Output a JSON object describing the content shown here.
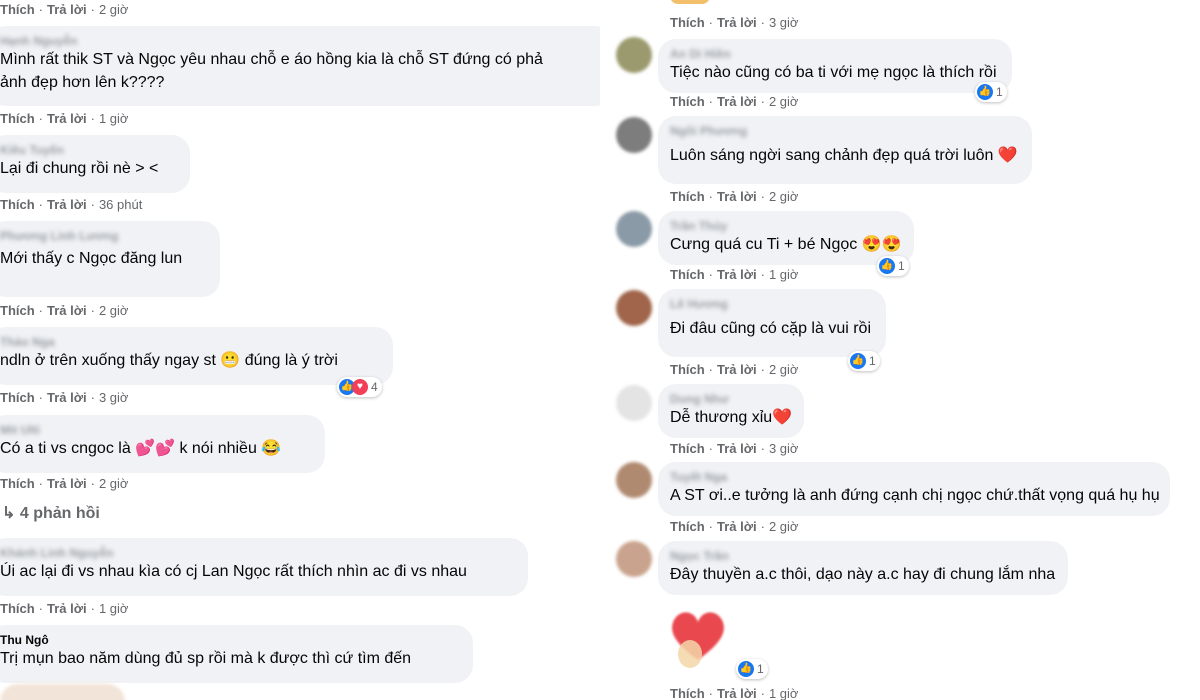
{
  "labels": {
    "like": "Thích",
    "reply": "Trả lời"
  },
  "left": {
    "top_time": "2 giờ",
    "comments": [
      {
        "author": "Hạnh Nguyễn",
        "lines": [
          "Mình rất thik ST và Ngọc yêu nhau chỗ e áo hồng kia là chỗ ST đứng có phả",
          "ảnh đẹp hơn lên k????"
        ],
        "time": "1 giờ"
      },
      {
        "author": "Kiều Tuyến",
        "lines": [
          "Lại đi chung rồi nè > <"
        ],
        "time": "36 phút"
      },
      {
        "author": "Phương Linh Lương",
        "lines": [
          "Mới thấy c Ngọc đăng lun"
        ],
        "time": "2 giờ"
      },
      {
        "author": "Thảo Nga",
        "lines": [
          "ndln ở trên xuống thấy ngay st 😬 đúng là ý trời"
        ],
        "time": "3 giờ",
        "reactions": "4"
      },
      {
        "author": "Mit Ulti",
        "lines": [
          "Có a ti vs cngoc là 💕💕 k nói nhiều 😂"
        ],
        "time": "2 giờ"
      },
      {
        "author": "Khánh Linh Nguyễn",
        "lines": [
          "Úi ac lại đi vs nhau kìa có cj Lan Ngọc rất thích nhìn ac đi vs nhau"
        ],
        "time": "1 giờ"
      },
      {
        "author": "Thu Ngô",
        "lines": [
          "Trị mụn bao năm dùng đủ sp rồi mà k được thì cứ tìm đến"
        ]
      }
    ],
    "replies_label": "4 phản hồi"
  },
  "right": {
    "top_time": "3 giờ",
    "comments": [
      {
        "author": "An Di Hiền",
        "text": "Tiệc nào cũng có ba ti với mẹ ngọc là thích rồi",
        "time": "2 giờ",
        "reactions": "1"
      },
      {
        "author": "Ngôi Phương",
        "text": "Luôn sáng ngời sang chảnh đẹp quá trời luôn ❤️",
        "time": "2 giờ"
      },
      {
        "author": "Trần Thủy",
        "text": "Cưng quá cu Ti + bé Ngọc 😍😍",
        "time": "1 giờ",
        "reactions": "1"
      },
      {
        "author": "Lê Hương",
        "text": "Đi đâu cũng có cặp là vui rồi",
        "time": "2 giờ",
        "reactions": "1"
      },
      {
        "author": "Dung Như",
        "text": "Dễ thương xỉu❤️",
        "time": "3 giờ"
      },
      {
        "author": "Tuyết Nga",
        "text": "A ST ơi..e tưởng là anh đứng cạnh chị ngọc chứ.thất vọng quá hụ hụ",
        "time": "2 giờ"
      },
      {
        "author": "Ngọc Trần",
        "text": "Đây thuyền a.c thôi, dạo này a.c hay đi chung lắm nha",
        "time": ""
      }
    ],
    "sticker_reactions": "1",
    "last_time": "1 giờ"
  },
  "colors": {
    "bubble": "#f0f2f5",
    "meta": "#65676b",
    "like_blue": "#1877f2",
    "heart_red": "#f33e58"
  }
}
